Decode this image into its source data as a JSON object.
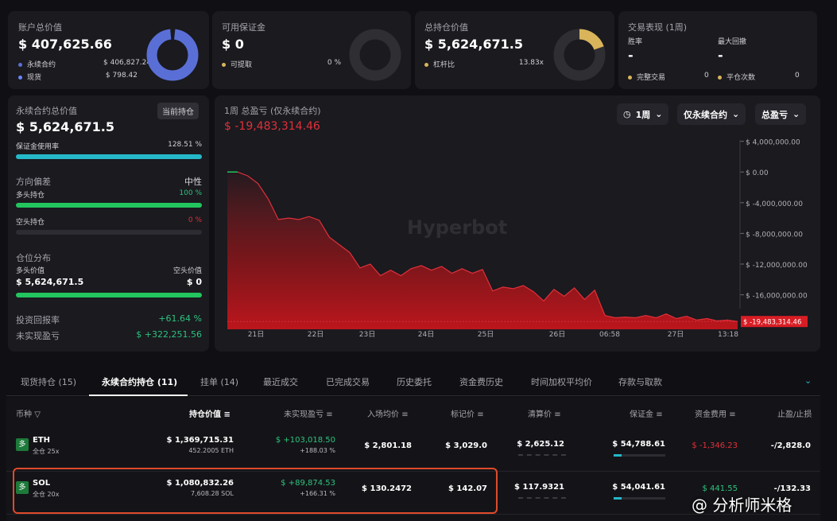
{
  "summary": {
    "account": {
      "title": "账户总价值",
      "value": "$ 407,625.66",
      "legend": [
        {
          "label": "永续合约",
          "value": "$ 406,827.24",
          "color": "#5a6fd6"
        },
        {
          "label": "现货",
          "value": "$ 798.42",
          "color": "#6a84ff"
        }
      ]
    },
    "margin": {
      "title": "可用保证金",
      "value": "$ 0",
      "legend": [
        {
          "label": "可提取",
          "value": "0 %",
          "color": "#d9b45a"
        }
      ]
    },
    "position": {
      "title": "总持仓价值",
      "value": "$ 5,624,671.5",
      "legend": [
        {
          "label": "杠杆比",
          "value": "13.83x",
          "color": "#d9b45a"
        }
      ]
    },
    "performance": {
      "title": "交易表现 (1周)",
      "winrate_label": "胜率",
      "winrate": "-",
      "drawdown_label": "最大回撤",
      "drawdown": "-",
      "done_label": "完整交易",
      "done": "0",
      "close_label": "平仓次数",
      "close": "0"
    }
  },
  "perp": {
    "title": "永续合约总价值",
    "badge": "当前持仓",
    "value": "$ 5,624,671.5",
    "usage_label": "保证金使用率",
    "usage": "128.51 %",
    "bias_label": "方向偏差",
    "bias": "中性",
    "long_label": "多头持仓",
    "long_pct": "100 %",
    "short_label": "空头持仓",
    "short_pct": "0 %",
    "dist_label": "仓位分布",
    "long_value_label": "多头价值",
    "short_value_label": "空头价值",
    "long_value": "$ 5,624,671.5",
    "short_value": "$ 0",
    "roi_label": "投资回报率",
    "roi": "+61.64 %",
    "upnl_label": "未实现盈亏",
    "upnl": "$ +322,251.56"
  },
  "chart_data": {
    "type": "area",
    "title": "1周 总盈亏 (仅永续合约)",
    "headline": "$ -19,483,314.46",
    "controls": {
      "range": "1周",
      "filter": "仅永续合约",
      "metric": "总盈亏"
    },
    "watermark": "Hyperbot",
    "x_ticks": [
      "21日",
      "22日",
      "23日",
      "24日",
      "25日",
      "26日",
      "06:58",
      "27日",
      "13:18"
    ],
    "y_ticks": [
      "$ 4,000,000.00",
      "$ 0.00",
      "$ -4,000,000.00",
      "$ -8,000,000.00",
      "$ -12,000,000.00",
      "$ -16,000,000.00"
    ],
    "ylim": [
      5000000,
      -20500000
    ],
    "last_label": "$ -19,483,314.46",
    "values": [
      0,
      0,
      -500000,
      -1500000,
      -3500000,
      -6200000,
      -6000000,
      -6200000,
      -5800000,
      -6300000,
      -8500000,
      -9500000,
      -10500000,
      -12500000,
      -12000000,
      -13500000,
      -12800000,
      -13500000,
      -12600000,
      -12200000,
      -12800000,
      -12300000,
      -13200000,
      -12600000,
      -13200000,
      -12700000,
      -15500000,
      -15000000,
      -15200000,
      -14800000,
      -15600000,
      -16800000,
      -15300000,
      -16200000,
      -15100000,
      -16600000,
      -15400000,
      -18700000,
      -19000000,
      -18900000,
      -19000000,
      -18700000,
      -19000000,
      -18500000,
      -19100000,
      -18800000,
      -19300000,
      -19100000,
      -19400000,
      -19300000,
      -19483314
    ]
  },
  "tabs": [
    "现货持仓 (15)",
    "永续合约持仓 (11)",
    "挂单 (14)",
    "最近成交",
    "已完成交易",
    "历史委托",
    "资金费历史",
    "时间加权平均价",
    "存款与取款"
  ],
  "columns": [
    "币种",
    "持仓价值",
    "未实现盈亏",
    "入场均价",
    "标记价",
    "清算价",
    "保证金",
    "资金费用",
    "止盈/止损"
  ],
  "rows": [
    {
      "side": "多",
      "coin": "ETH",
      "mode": "全仓 25x",
      "value": "$ 1,369,715.31",
      "size": "452.2005 ETH",
      "pnl": "$ +103,018.50",
      "pnl_pct": "+188.03 %",
      "entry": "$ 2,801.18",
      "mark": "$ 3,029.0",
      "liq": "$ 2,625.12",
      "margin": "$ 54,788.61",
      "funding": "$ -1,346.23",
      "tpsl": "-/2,828.0"
    },
    {
      "side": "多",
      "coin": "SOL",
      "mode": "全仓 20x",
      "value": "$ 1,080,832.26",
      "size": "7,608.28 SOL",
      "pnl": "$ +89,874.53",
      "pnl_pct": "+166.31 %",
      "entry": "$ 130.2472",
      "mark": "$ 142.07",
      "liq": "$ 117.9321",
      "margin": "$ 54,041.61",
      "funding": "$ 441.55",
      "tpsl": "-/132.33"
    }
  ],
  "watermark_text": "@ 分析师米格"
}
